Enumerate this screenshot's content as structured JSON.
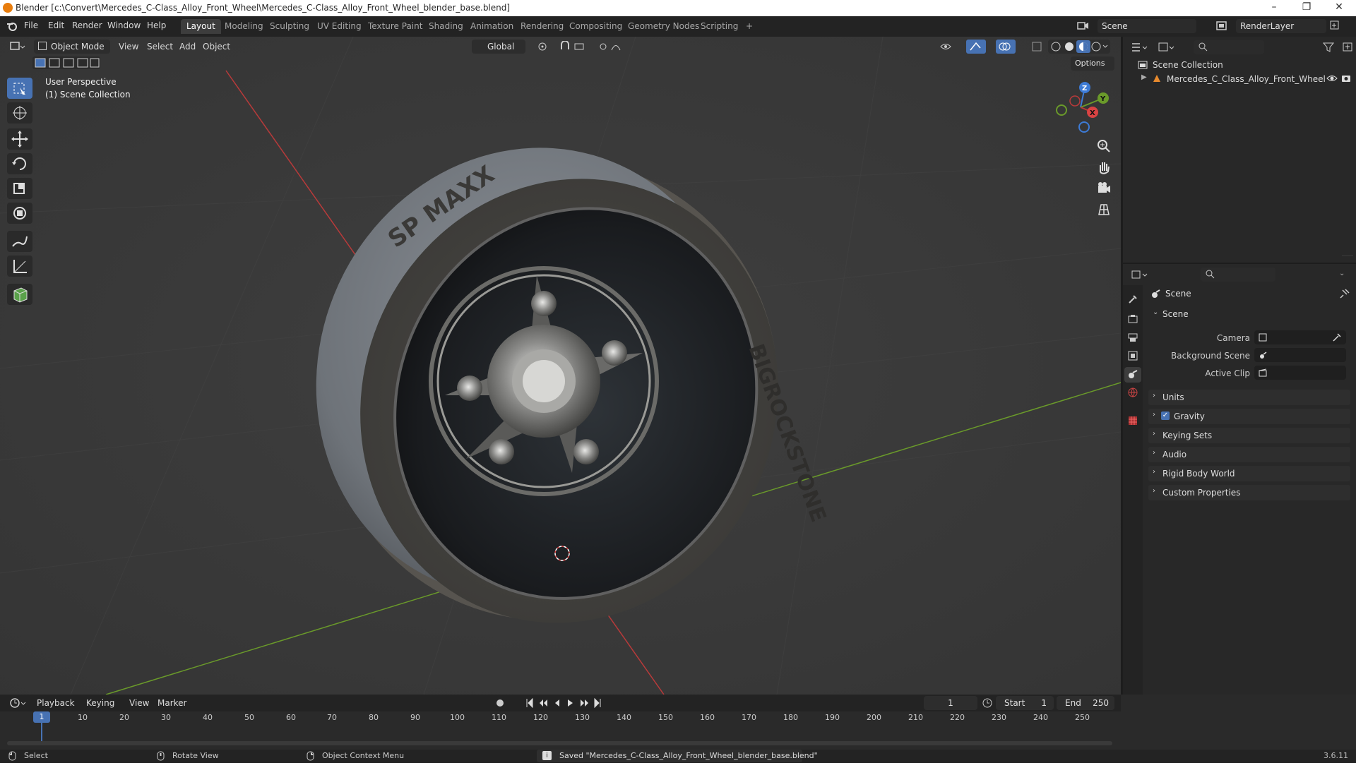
{
  "window": {
    "title": "Blender [c:\\Convert\\Mercedes_C-Class_Alloy_Front_Wheel\\Mercedes_C-Class_Alloy_Front_Wheel_blender_base.blend]",
    "controls": [
      "–",
      "❐",
      "✕"
    ]
  },
  "menus": [
    "File",
    "Edit",
    "Render",
    "Window",
    "Help"
  ],
  "workspaces": [
    {
      "label": "Layout",
      "active": true
    },
    {
      "label": "Modeling"
    },
    {
      "label": "Sculpting"
    },
    {
      "label": "UV Editing"
    },
    {
      "label": "Texture Paint"
    },
    {
      "label": "Shading"
    },
    {
      "label": "Animation"
    },
    {
      "label": "Rendering"
    },
    {
      "label": "Compositing"
    },
    {
      "label": "Geometry Nodes"
    },
    {
      "label": "Scripting"
    }
  ],
  "add_workspace": "+",
  "scene_field": "Scene",
  "view_layer_field": "RenderLayer",
  "viewport": {
    "mode": "Object Mode",
    "menus": [
      "View",
      "Select",
      "Add",
      "Object"
    ],
    "transform_orientation": "Global",
    "options_label": "Options",
    "overlay_line1": "User Perspective",
    "overlay_line2": "(1) Scene Collection",
    "gizmo": {
      "x": "X",
      "y": "Y",
      "z": "Z"
    },
    "tire_text": [
      "BIGROCKSTONE",
      "SP MAXX"
    ]
  },
  "outliner": {
    "root": "Scene Collection",
    "items": [
      {
        "label": "Mercedes_C_Class_Alloy_Front_Wheel"
      }
    ]
  },
  "properties": {
    "header": "Scene",
    "scene_panel": "Scene",
    "fields": [
      {
        "label": "Camera",
        "value": ""
      },
      {
        "label": "Background Scene",
        "value": ""
      },
      {
        "label": "Active Clip",
        "value": ""
      }
    ],
    "panels": [
      {
        "label": "Units"
      },
      {
        "label": "Gravity",
        "checked": true
      },
      {
        "label": "Keying Sets"
      },
      {
        "label": "Audio"
      },
      {
        "label": "Rigid Body World"
      },
      {
        "label": "Custom Properties"
      }
    ]
  },
  "timeline": {
    "menus": [
      "Playback",
      "Keying",
      "View",
      "Marker"
    ],
    "current_frame": "1",
    "start_label": "Start",
    "start_value": "1",
    "end_label": "End",
    "end_value": "250",
    "ticks": [
      "10",
      "20",
      "30",
      "40",
      "50",
      "60",
      "70",
      "80",
      "90",
      "100",
      "110",
      "120",
      "130",
      "140",
      "150",
      "160",
      "170",
      "180",
      "190",
      "200",
      "210",
      "220",
      "230",
      "240",
      "250"
    ]
  },
  "statusbar": {
    "select": "Select",
    "rotate": "Rotate View",
    "context": "Object Context Menu",
    "message": "Saved \"Mercedes_C-Class_Alloy_Front_Wheel_blender_base.blend\"",
    "version": "3.6.11"
  },
  "colors": {
    "accent": "#4772b3",
    "x_axis": "#b83a3a",
    "y_axis": "#6a9a2a",
    "z_axis": "#3d7bd6"
  }
}
